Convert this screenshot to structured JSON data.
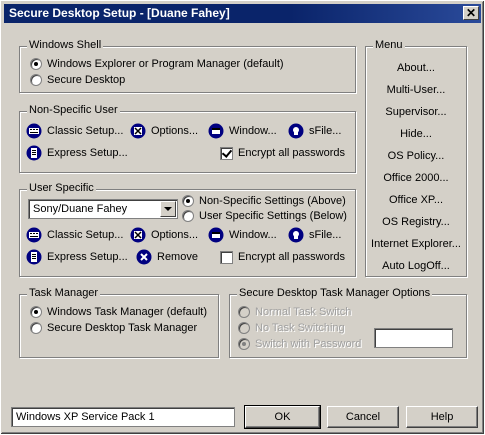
{
  "window": {
    "title": "Secure Desktop Setup - [Duane Fahey]",
    "close_glyph": "✕"
  },
  "windows_shell": {
    "title": "Windows Shell",
    "options": [
      "Windows Explorer or Program Manager (default)",
      "Secure Desktop"
    ],
    "selected": 0
  },
  "non_specific_user": {
    "title": "Non-Specific User",
    "classic_setup": "Classic Setup...",
    "options": "Options...",
    "window": "Window...",
    "sfile": "sFile...",
    "express_setup": "Express Setup...",
    "encrypt": "Encrypt all passwords",
    "encrypt_checked": true
  },
  "user_specific": {
    "title": "User Specific",
    "user_select": "Sony/Duane Fahey",
    "setting_options": [
      "Non-Specific Settings (Above)",
      "User Specific Settings (Below)"
    ],
    "selected": 0,
    "classic_setup": "Classic Setup...",
    "options": "Options...",
    "window": "Window...",
    "sfile": "sFile...",
    "express_setup": "Express Setup...",
    "remove": "Remove",
    "encrypt": "Encrypt all passwords",
    "encrypt_checked": false
  },
  "menu": {
    "title": "Menu",
    "items": [
      "About...",
      "Multi-User...",
      "Supervisor...",
      "Hide...",
      "OS Policy...",
      "Office 2000...",
      "Office XP...",
      "OS Registry...",
      "Internet Explorer...",
      "Auto LogOff..."
    ]
  },
  "task_manager": {
    "title": "Task Manager",
    "options": [
      "Windows Task Manager (default)",
      "Secure Desktop Task Manager"
    ],
    "selected": 0
  },
  "sd_task_manager_options": {
    "title": "Secure Desktop Task Manager Options",
    "options": [
      "Normal Task Switch",
      "No Task Switching",
      "Switch with Password"
    ],
    "selected": 2,
    "password_value": ""
  },
  "footer": {
    "status_text": "Windows XP Service Pack 1",
    "ok": "OK",
    "cancel": "Cancel",
    "help": "Help"
  },
  "icons": {
    "classic_setup": "keyboard-icon",
    "options": "options-x-icon",
    "window": "window-icon",
    "sfile": "sfile-icon",
    "express_setup": "express-icon",
    "remove": "remove-icon"
  },
  "colors": {
    "titlebar": "#0a246a",
    "face": "#d4d0c8",
    "icon_blue": "#000080"
  }
}
